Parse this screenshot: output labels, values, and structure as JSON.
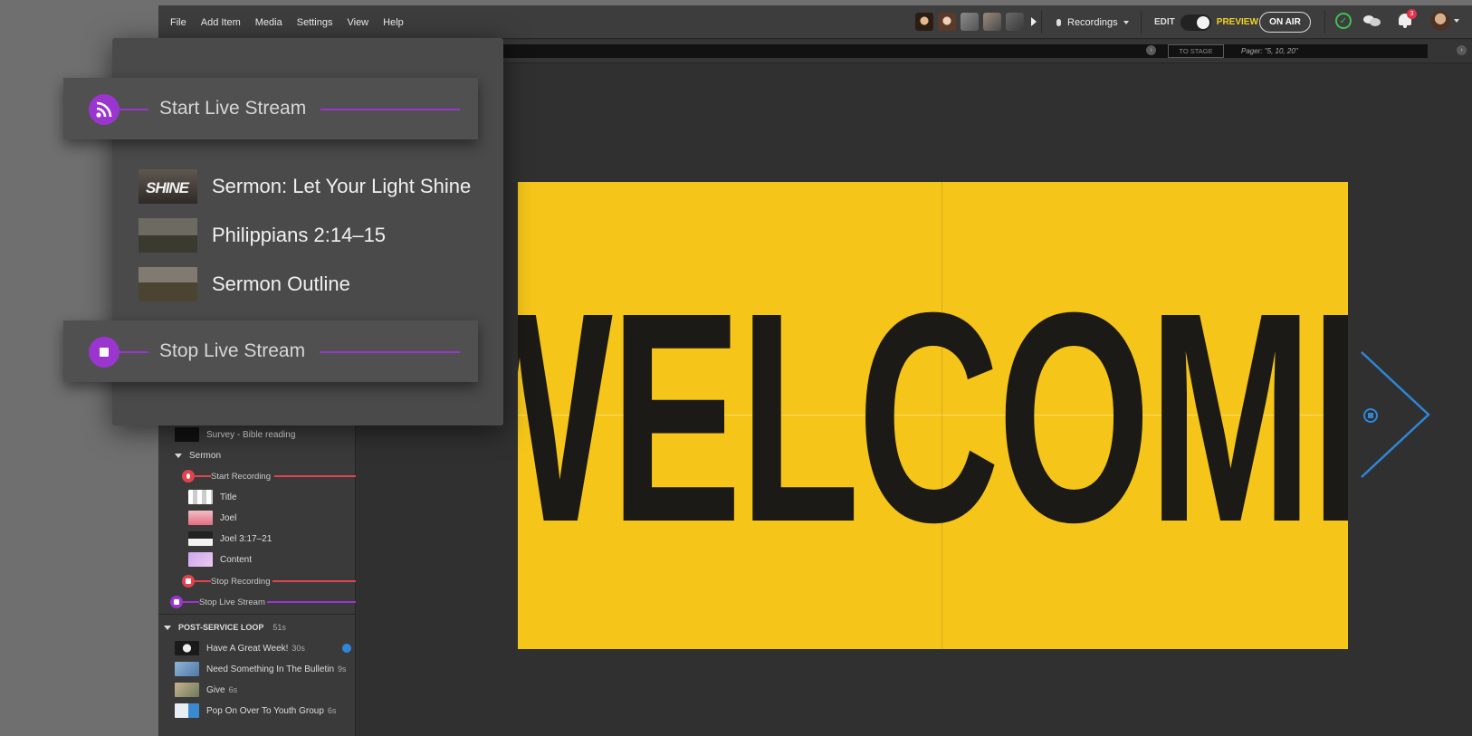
{
  "menu": [
    "File",
    "Add Item",
    "Media",
    "Settings",
    "View",
    "Help"
  ],
  "recordings_label": "Recordings",
  "mode": {
    "edit": "EDIT",
    "preview": "PREVIEW"
  },
  "on_air": "ON AIR",
  "notifications_count": "3",
  "toolbar": {
    "to_stage": "TO STAGE",
    "pager": "Pager: \"5, 10, 20\""
  },
  "popup": {
    "start_stream": "Start Live Stream",
    "items": [
      "Sermon: Let Your Light Shine",
      "Philippians 2:14–15",
      "Sermon Outline"
    ],
    "thumb_text": "SHINE",
    "stop_stream": "Stop Live Stream"
  },
  "sidebar": {
    "survey": "Survey - Bible reading",
    "section": "Sermon",
    "start_recording": "Start Recording",
    "items": [
      "Title",
      "Joel",
      "Joel 3:17–21",
      "Content"
    ],
    "stop_recording": "Stop Recording",
    "stop_stream": "Stop Live Stream",
    "post_loop": {
      "title": "POST-SERVICE LOOP",
      "duration": "51s"
    },
    "loop_items": [
      {
        "label": "Have A Great Week!",
        "dur": "30s"
      },
      {
        "label": "Need Something In The Bulletin",
        "dur": "9s"
      },
      {
        "label": "Give",
        "dur": "6s"
      },
      {
        "label": "Pop On Over To Youth Group",
        "dur": "6s"
      }
    ]
  },
  "stage_text": "WELCOME",
  "colors": {
    "purple": "#9b35d0",
    "red": "#e2434f",
    "blue": "#2f86d6",
    "yellow": "#f5c51a",
    "green": "#3fbf56"
  }
}
